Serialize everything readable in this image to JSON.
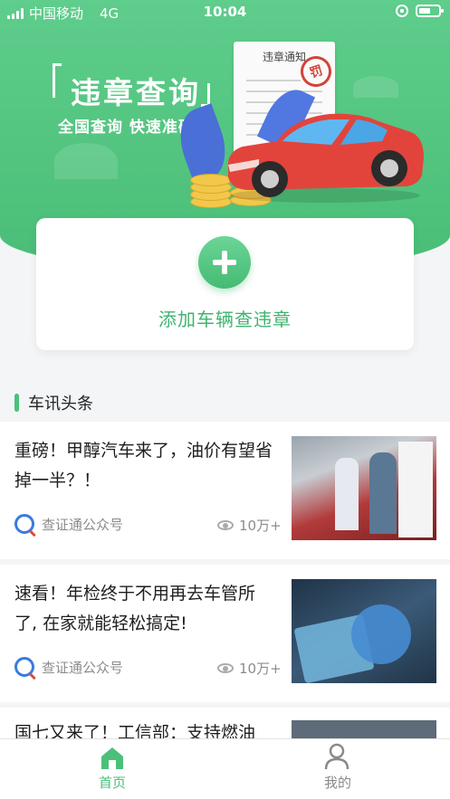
{
  "status_bar": {
    "carrier": "中国移动",
    "network": "4G",
    "time": "10:04"
  },
  "hero": {
    "title": "违章查询",
    "subtitle": "全国查询  快速准确",
    "notice_title": "违章通知",
    "stamp_text": "罚"
  },
  "add_vehicle": {
    "label": "添加车辆查违章"
  },
  "news_section": {
    "title": "车讯头条",
    "items": [
      {
        "title": "重磅！甲醇汽车来了，油价有望省掉一半？！",
        "source": "查证通公众号",
        "views": "10万+"
      },
      {
        "title": "速看！年检终于不用再去车管所了, 在家就能轻松搞定!",
        "source": "查证通公众号",
        "views": "10万+"
      },
      {
        "title": "国七又来了！工信部：支持燃油",
        "source": "",
        "views": ""
      }
    ]
  },
  "tab_bar": {
    "home": "首页",
    "mine": "我的"
  },
  "colors": {
    "brand_green": "#4cc07b",
    "inactive_tab": "#8a8a8a"
  }
}
